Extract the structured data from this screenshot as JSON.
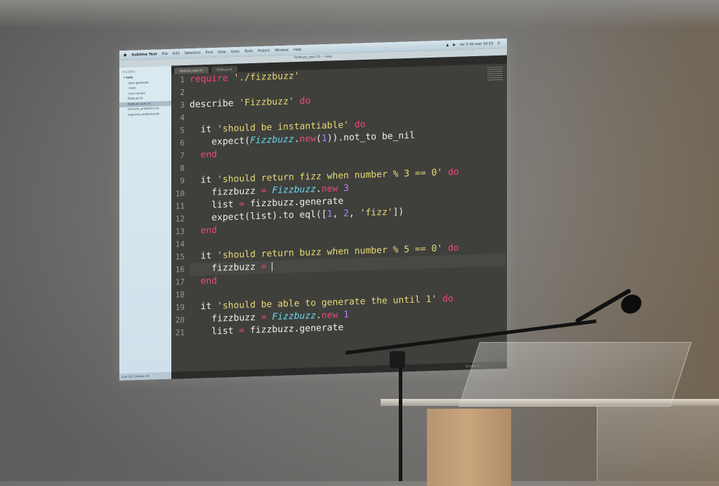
{
  "menubar": {
    "app": "Sublime Text",
    "items": [
      "File",
      "Edit",
      "Selection",
      "Find",
      "View",
      "Goto",
      "Tools",
      "Project",
      "Window",
      "Help"
    ],
    "clock": "ter 5 de mar 16:19"
  },
  "titlebar": {
    "title": "fizzbuzz_spec.rb — kata"
  },
  "sidebar": {
    "header": "FOLDERS",
    "root": "kata",
    "items": [
      ".bem-generate",
      ".rspec",
      "ruby-version",
      "fizzbuzz.rb",
      "fizzbuzz_spec.rb",
      "primeiro_problema.txt",
      "segundo_problema.txt"
    ],
    "footer": "Line 16, Column 14"
  },
  "tabs": [
    "fizzbuzz_spec.rb",
    "fizzbuzz.rb"
  ],
  "statusbar": {
    "right": "Spaces: 2"
  },
  "editor": {
    "lines": [
      {
        "n": "1",
        "tokens": [
          [
            "kw",
            "require "
          ],
          [
            "str",
            "'./fizzbuzz'"
          ]
        ]
      },
      {
        "n": "2",
        "tokens": []
      },
      {
        "n": "3",
        "tokens": [
          [
            "id",
            "describe "
          ],
          [
            "str",
            "'Fizzbuzz'"
          ],
          [
            "kw",
            " do"
          ]
        ]
      },
      {
        "n": "4",
        "tokens": []
      },
      {
        "n": "5",
        "tokens": [
          [
            "id",
            "  it "
          ],
          [
            "str",
            "'should be instantiable'"
          ],
          [
            "kw",
            " do"
          ]
        ]
      },
      {
        "n": "6",
        "tokens": [
          [
            "id",
            "    expect("
          ],
          [
            "cls",
            "Fizzbuzz"
          ],
          [
            "id",
            "."
          ],
          [
            "kw",
            "new"
          ],
          [
            "id",
            "("
          ],
          [
            "num",
            "1"
          ],
          [
            "id",
            ")).not_to be_nil"
          ]
        ]
      },
      {
        "n": "7",
        "tokens": [
          [
            "kw",
            "  end"
          ]
        ]
      },
      {
        "n": "8",
        "tokens": []
      },
      {
        "n": "9",
        "tokens": [
          [
            "id",
            "  it "
          ],
          [
            "str",
            "'should return fizz when number % 3 == 0'"
          ],
          [
            "kw",
            " do"
          ]
        ]
      },
      {
        "n": "10",
        "tokens": [
          [
            "id",
            "    fizzbuzz "
          ],
          [
            "op",
            "="
          ],
          [
            "id",
            " "
          ],
          [
            "cls",
            "Fizzbuzz"
          ],
          [
            "id",
            "."
          ],
          [
            "kw",
            "new "
          ],
          [
            "num",
            "3"
          ]
        ]
      },
      {
        "n": "11",
        "tokens": [
          [
            "id",
            "    list "
          ],
          [
            "op",
            "="
          ],
          [
            "id",
            " fizzbuzz.generate"
          ]
        ]
      },
      {
        "n": "12",
        "tokens": [
          [
            "id",
            "    expect(list).to eql(["
          ],
          [
            "num",
            "1"
          ],
          [
            "id",
            ", "
          ],
          [
            "num",
            "2"
          ],
          [
            "id",
            ", "
          ],
          [
            "str",
            "'fizz'"
          ],
          [
            "id",
            "])"
          ]
        ]
      },
      {
        "n": "13",
        "tokens": [
          [
            "kw",
            "  end"
          ]
        ]
      },
      {
        "n": "14",
        "tokens": []
      },
      {
        "n": "15",
        "tokens": [
          [
            "id",
            "  it "
          ],
          [
            "str",
            "'should return buzz when number % 5 == 0'"
          ],
          [
            "kw",
            " do"
          ]
        ]
      },
      {
        "n": "16",
        "tokens": [
          [
            "id",
            "    fizzbuzz "
          ],
          [
            "op",
            "="
          ],
          [
            "id",
            " "
          ]
        ],
        "cursor": true
      },
      {
        "n": "17",
        "tokens": [
          [
            "kw",
            "  end"
          ]
        ]
      },
      {
        "n": "18",
        "tokens": []
      },
      {
        "n": "19",
        "tokens": [
          [
            "id",
            "  it "
          ],
          [
            "str",
            "'should be able to generate the until 1'"
          ],
          [
            "kw",
            " do"
          ]
        ]
      },
      {
        "n": "20",
        "tokens": [
          [
            "id",
            "    fizzbuzz "
          ],
          [
            "op",
            "="
          ],
          [
            "id",
            " "
          ],
          [
            "cls",
            "Fizzbuzz"
          ],
          [
            "id",
            "."
          ],
          [
            "kw",
            "new "
          ],
          [
            "num",
            "1"
          ]
        ]
      },
      {
        "n": "21",
        "tokens": [
          [
            "id",
            "    list "
          ],
          [
            "op",
            "="
          ],
          [
            "id",
            " fizzbuzz.generate"
          ]
        ]
      }
    ]
  }
}
